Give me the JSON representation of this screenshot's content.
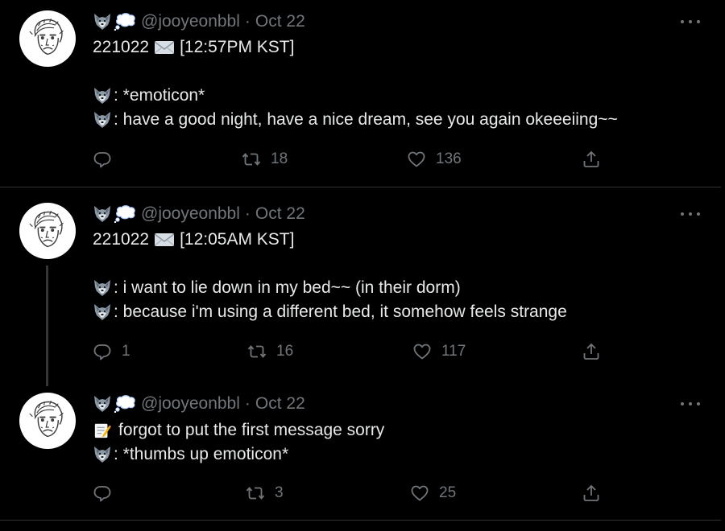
{
  "colors": {
    "background": "#000000",
    "text_primary": "#e7e9ea",
    "text_secondary": "#71767b",
    "divider": "#2f3336",
    "thread_line": "#333639"
  },
  "tweets": [
    {
      "handle": "@jooyeonbbl",
      "date": "Oct 22",
      "name_icons": [
        "wolf-face-icon",
        "thought-balloon-icon"
      ],
      "lines": [
        {
          "emoji": "envelope-icon",
          "prefix": "221022",
          "text": "[12:57PM KST]"
        },
        {
          "blank": true
        },
        {
          "emoji": "wolf-face-icon",
          "text": ": *emoticon*"
        },
        {
          "emoji": "wolf-face-icon",
          "text": ": have a good night, have a nice dream, see you again okeeeiing~~"
        }
      ],
      "actions": {
        "reply": "",
        "retweet": "18",
        "like": "136"
      }
    },
    {
      "handle": "@jooyeonbbl",
      "date": "Oct 22",
      "name_icons": [
        "wolf-face-icon",
        "thought-balloon-icon"
      ],
      "lines": [
        {
          "emoji": "envelope-icon",
          "prefix": "221022",
          "text": "[12:05AM KST]"
        },
        {
          "blank": true
        },
        {
          "emoji": "wolf-face-icon",
          "text": ": i want to lie down in my bed~~ (in their dorm)"
        },
        {
          "emoji": "wolf-face-icon",
          "text": ": because i'm using a different bed, it somehow feels strange"
        }
      ],
      "actions": {
        "reply": "1",
        "retweet": "16",
        "like": "117"
      }
    },
    {
      "handle": "@jooyeonbbl",
      "date": "Oct 22",
      "name_icons": [
        "wolf-face-icon",
        "thought-balloon-icon"
      ],
      "lines": [
        {
          "emoji": "memo-icon",
          "text": "forgot to put the first message sorry"
        },
        {
          "emoji": "wolf-face-icon",
          "text": ": *thumbs up emoticon*"
        }
      ],
      "actions": {
        "reply": "",
        "retweet": "3",
        "like": "25"
      }
    }
  ]
}
